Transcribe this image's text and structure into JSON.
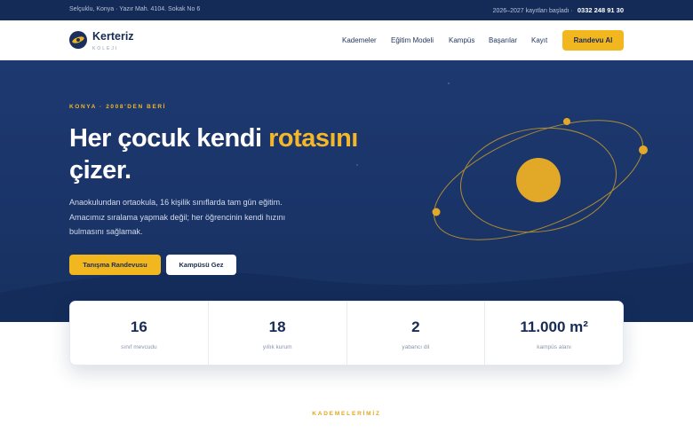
{
  "topbar": {
    "address": "Selçuklu, Konya · Yazır Mah. 4104. Sokak No 6",
    "enrollment_note": "2026–2027 kayıtları başladı ·",
    "phone": "0332 248 91 30"
  },
  "nav": {
    "brand": "Kerteriz",
    "brand_sub": "KOLEJI",
    "items": [
      "Kademeler",
      "Eğitim Modeli",
      "Kampüs",
      "Başarılar",
      "Kayıt"
    ],
    "cta": "Randevu Al"
  },
  "hero": {
    "kicker": "KONYA · 2008'DEN BERİ",
    "headline_part1": "Her çocuk kendi ",
    "headline_accent": "rotasını",
    "headline_part2": "çizer.",
    "lead": "Anaokulundan ortaokula, 16 kişilik sınıflarda tam gün eğitim. Amacımız sıralama yapmak değil; her öğrencinin kendi hızını bulmasını sağlamak.",
    "primary_button": "Tanışma Randevusu",
    "secondary_button": "Kampüsü Gez"
  },
  "stats": [
    {
      "value": "16",
      "label": "sınıf mevcudu"
    },
    {
      "value": "18",
      "label": "yıllık kurum"
    },
    {
      "value": "2",
      "label": "yabancı dil"
    },
    {
      "value": "11.000 m²",
      "label": "kampüs alanı"
    }
  ],
  "section": {
    "kicker": "KADEMELERİMİZ"
  },
  "colors": {
    "navy": "#142a57",
    "accent": "#f2b71f"
  }
}
